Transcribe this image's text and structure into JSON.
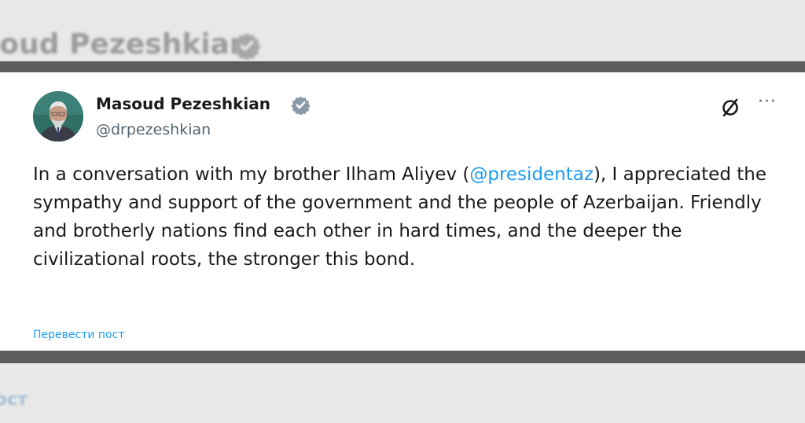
{
  "background": {
    "blurred_name": "soud Pezeshkian",
    "blurred_post_link": "ост"
  },
  "tweet": {
    "author_name": "Masoud Pezeshkian",
    "handle": "@drpezeshkian",
    "text_before": "In a conversation with my brother Ilham Aliyev (",
    "mention": "@presidentaz",
    "text_after": "), I appreciated the sympathy and support of the government and the people of Azerbaijan. Friendly and brotherly nations find each other in hard times, and the deeper the civilizational roots, the stronger this bond.",
    "translate_link": "Перевести пост",
    "more_label": "···"
  },
  "colors": {
    "link": "#1d9bf0",
    "verified_badge": "#8a9aa8",
    "text": "#1a1a1a",
    "secondary": "#536471",
    "frame": "#5c5c5c"
  },
  "icons": {
    "verified": "verified-badge-icon",
    "grok": "grok-slash-icon",
    "more": "more-dots-icon"
  }
}
